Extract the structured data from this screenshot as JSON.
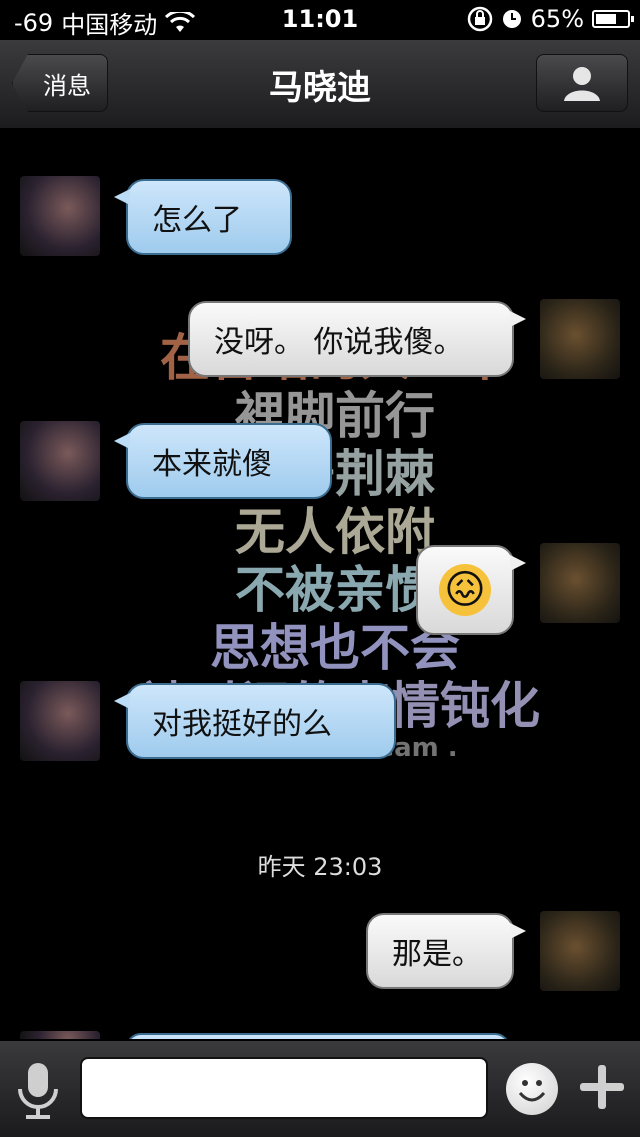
{
  "status_bar": {
    "signal": "-69",
    "carrier": "中国移动",
    "time": "11:01",
    "battery": "65%",
    "battery_level": 0.65,
    "icons": [
      "wifi-icon",
      "orientation-lock-icon",
      "alarm-icon",
      "battery-icon"
    ]
  },
  "nav": {
    "back_label": "消息",
    "title": "马晓迪",
    "profile_icon": "person-icon"
  },
  "wallpaper": {
    "lines": [
      "在昏暗的人世中",
      "裡脚前行",
      "拨开荆棘",
      "无人依附",
      "不被亲惯",
      "思想也不会",
      "被时间的事情钝化",
      "lose and dream ."
    ]
  },
  "messages": [
    {
      "side": "friend",
      "text": "怎么了"
    },
    {
      "side": "me",
      "text": "没呀。 你说我傻。"
    },
    {
      "side": "friend",
      "text": "本来就傻"
    },
    {
      "side": "me",
      "text": "😖",
      "type": "emoji"
    },
    {
      "side": "friend",
      "text": "对我挺好的么"
    },
    {
      "side": "me",
      "text": "那是。"
    }
  ],
  "timestamp": "昨天 23:03",
  "input": {
    "placeholder": "",
    "value": "",
    "icons": [
      "microphone-icon",
      "emoji-icon",
      "plus-icon"
    ]
  }
}
